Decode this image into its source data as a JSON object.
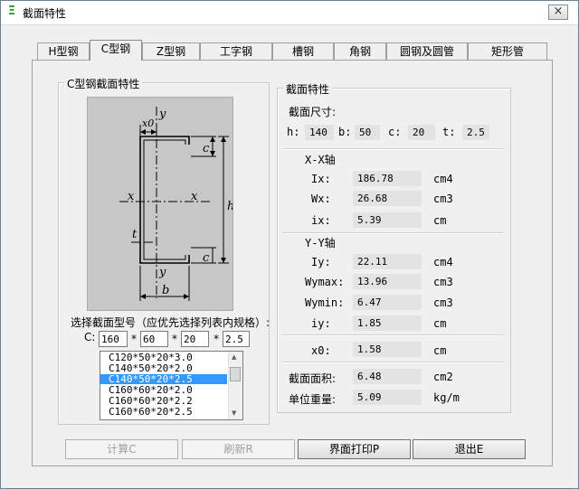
{
  "window": {
    "title": "截面特性",
    "app_icon": "steel-icon",
    "close_glyph": "×"
  },
  "tabs": [
    {
      "label": "H型钢",
      "active": false
    },
    {
      "label": "C型钢",
      "active": true
    },
    {
      "label": "Z型钢",
      "active": false
    },
    {
      "label": "工字钢",
      "active": false
    },
    {
      "label": "槽钢",
      "active": false
    },
    {
      "label": "角钢",
      "active": false
    },
    {
      "label": "圆钢及圆管",
      "active": false
    },
    {
      "label": "矩形管",
      "active": false
    }
  ],
  "left_group": {
    "title": "C型钢截面特性",
    "diagram": {
      "labels": {
        "y_top": "y",
        "x0": "x0",
        "c_top": "c",
        "x_left": "x",
        "x_right": "x",
        "h": "h",
        "t": "t",
        "c_bottom": "c",
        "y_bottom": "y",
        "b": "b"
      }
    },
    "select_prompt": "选择截面型号（应优先选择列表内规格）:",
    "c_prefix": "C:",
    "inputs": [
      "160",
      "60",
      "20",
      "2.5"
    ],
    "star": "*",
    "list": {
      "items": [
        "C120*50*20*3.0",
        "C140*50*20*2.0",
        "C140*50*20*2.5",
        "C160*60*20*2.0",
        "C160*60*20*2.2",
        "C160*60*20*2.5"
      ],
      "selected_index": 2
    }
  },
  "right_group": {
    "title": "截面特性",
    "dims_title": "截面尺寸:",
    "dims": [
      {
        "label": "h:",
        "value": "140"
      },
      {
        "label": "b:",
        "value": "50"
      },
      {
        "label": "c:",
        "value": "20"
      },
      {
        "label": "t:",
        "value": "2.5"
      }
    ],
    "xx_title": "X-X轴",
    "xx": [
      {
        "label": "Ix:",
        "value": "186.78",
        "unit": "cm4"
      },
      {
        "label": "Wx:",
        "value": "26.68",
        "unit": "cm3"
      },
      {
        "label": "ix:",
        "value": "5.39",
        "unit": "cm"
      }
    ],
    "yy_title": "Y-Y轴",
    "yy": [
      {
        "label": "Iy:",
        "value": "22.11",
        "unit": "cm4"
      },
      {
        "label": "Wymax:",
        "value": "13.96",
        "unit": "cm3"
      },
      {
        "label": "Wymin:",
        "value": "6.47",
        "unit": "cm3"
      },
      {
        "label": "iy:",
        "value": "1.85",
        "unit": "cm"
      }
    ],
    "x0": {
      "label": "x0:",
      "value": "1.58",
      "unit": "cm"
    },
    "area": {
      "label": "截面面积:",
      "value": "6.48",
      "unit": "cm2"
    },
    "weight": {
      "label": "单位重量:",
      "value": "5.09",
      "unit": "kg/m"
    }
  },
  "buttons": {
    "calc": "计算C",
    "refresh": "刷新R",
    "print": "界面打印P",
    "exit": "退出E"
  }
}
